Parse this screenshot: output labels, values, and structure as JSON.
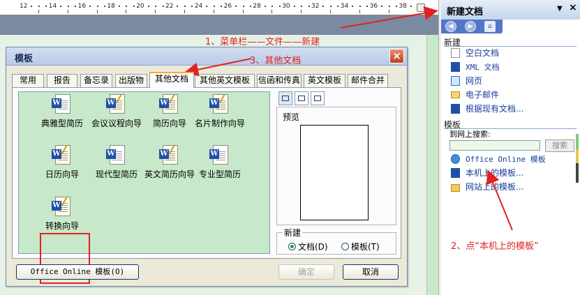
{
  "ruler": {
    "numbers": [
      "12",
      "14",
      "16",
      "18",
      "20",
      "22",
      "24",
      "26",
      "28",
      "30",
      "32",
      "34",
      "36",
      "38"
    ]
  },
  "dialog": {
    "title": "模板",
    "close": "×",
    "tabs": [
      {
        "label": "常用"
      },
      {
        "label": "报告"
      },
      {
        "label": "备忘录"
      },
      {
        "label": "出版物"
      },
      {
        "label": "其他文档",
        "active": true
      },
      {
        "label": "其他英文模板"
      },
      {
        "label": "信函和传真"
      },
      {
        "label": "英文模板"
      },
      {
        "label": "邮件合并"
      }
    ],
    "templates": [
      {
        "label": "典雅型简历",
        "kind": "doc"
      },
      {
        "label": "会议议程向导",
        "kind": "wizard"
      },
      {
        "label": "简历向导",
        "kind": "wizard"
      },
      {
        "label": "名片制作向导",
        "kind": "wizard"
      },
      {
        "label": "日历向导",
        "kind": "wizard"
      },
      {
        "label": "现代型简历",
        "kind": "doc"
      },
      {
        "label": "英文简历向导",
        "kind": "wizard"
      },
      {
        "label": "专业型简历",
        "kind": "doc"
      },
      {
        "label": "转换向导",
        "kind": "wizard"
      }
    ],
    "preview_label": "预览",
    "new_group": {
      "label": "新建",
      "doc": "文档(D)",
      "template": "模板(T)",
      "selected": "doc"
    },
    "buttons": {
      "online": "Office Online 模板(O)",
      "ok": "确定",
      "cancel": "取消"
    }
  },
  "task_pane": {
    "title": "新建文档",
    "dropdown": "▼",
    "close": "×",
    "sections": {
      "new": "新建",
      "templates": "模板"
    },
    "new_links": [
      "空白文档",
      "XML 文档",
      "网页",
      "电子邮件",
      "根据现有文档..."
    ],
    "search_label": "到网上搜索:",
    "search_value": "",
    "search_button": "搜索",
    "template_links": [
      "Office Online 模板",
      "本机上的模板...",
      "网站上的模板..."
    ]
  },
  "annotations": {
    "step1": "1、菜单栏——文件——新建",
    "step2": "2、点“本机上的模板”",
    "step3": "3、其他文档",
    "color": "#e02222"
  }
}
